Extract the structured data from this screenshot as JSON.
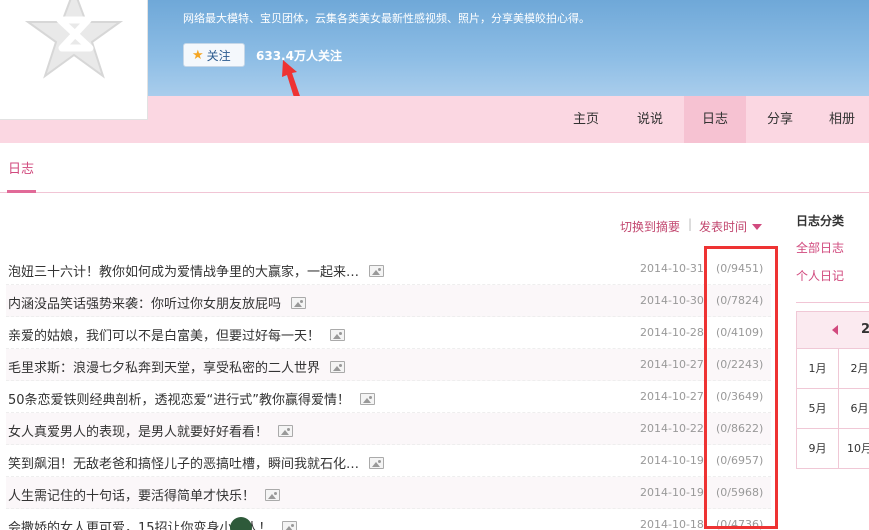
{
  "header": {
    "tagline": "网络最大模特、宝贝团体，云集各类美女最新性感视频、照片，分享美模皎拍心得。",
    "follow_label": "关注",
    "follower_count": "633.4万人关注"
  },
  "nav": {
    "items": [
      {
        "label": "主页"
      },
      {
        "label": "说说"
      },
      {
        "label": "日志"
      },
      {
        "label": "分享"
      },
      {
        "label": "相册"
      }
    ],
    "active": "日志"
  },
  "section": {
    "title": "日志"
  },
  "toolbar": {
    "switch_label": "切换到摘要",
    "separator": "|",
    "sort_label": "发表时间"
  },
  "blogs": [
    {
      "title": "泡妞三十六计！教你如何成为爱情战争里的大赢家，一起来…",
      "date": "2014-10-31",
      "count": "(0/9451)"
    },
    {
      "title": "内涵没品笑话强势来袭：你听过你女朋友放屁吗",
      "date": "2014-10-30",
      "count": "(0/7824)"
    },
    {
      "title": "亲爱的姑娘，我们可以不是白富美，但要过好每一天！",
      "date": "2014-10-28",
      "count": "(0/4109)"
    },
    {
      "title": "毛里求斯：浪漫七夕私奔到天堂，享受私密的二人世界",
      "date": "2014-10-27",
      "count": "(0/2243)"
    },
    {
      "title": "50条恋爱铁则经典剖析，透视恋爱“进行式”教你赢得爱情！",
      "date": "2014-10-27",
      "count": "(0/3649)"
    },
    {
      "title": "女人真爱男人的表现，是男人就要好好看看！",
      "date": "2014-10-22",
      "count": "(0/8622)"
    },
    {
      "title": "笑到飙泪！无敌老爸和搞怪儿子的恶搞吐槽，瞬间我就石化…",
      "date": "2014-10-19",
      "count": "(0/6957)"
    },
    {
      "title": "人生需记住的十句话，要活得简单才快乐！",
      "date": "2014-10-19",
      "count": "(0/5968)"
    },
    {
      "title": "会撒娇的女人更可爱，15招让你变身小女人！",
      "date": "2014-10-18",
      "count": "(0/4736)"
    }
  ],
  "sidebar": {
    "title": "日志分类",
    "links": [
      "全部日志",
      "个人日记"
    ]
  },
  "calendar": {
    "year": "2",
    "months": [
      [
        "1月",
        "2月"
      ],
      [
        "5月",
        "6月"
      ],
      [
        "9月",
        "10月"
      ]
    ]
  },
  "colors": {
    "accent": "#d14a7e",
    "nav_bg": "#fbd7e2",
    "banner": "#8dbde5",
    "highlight_box": "#ee3333"
  }
}
